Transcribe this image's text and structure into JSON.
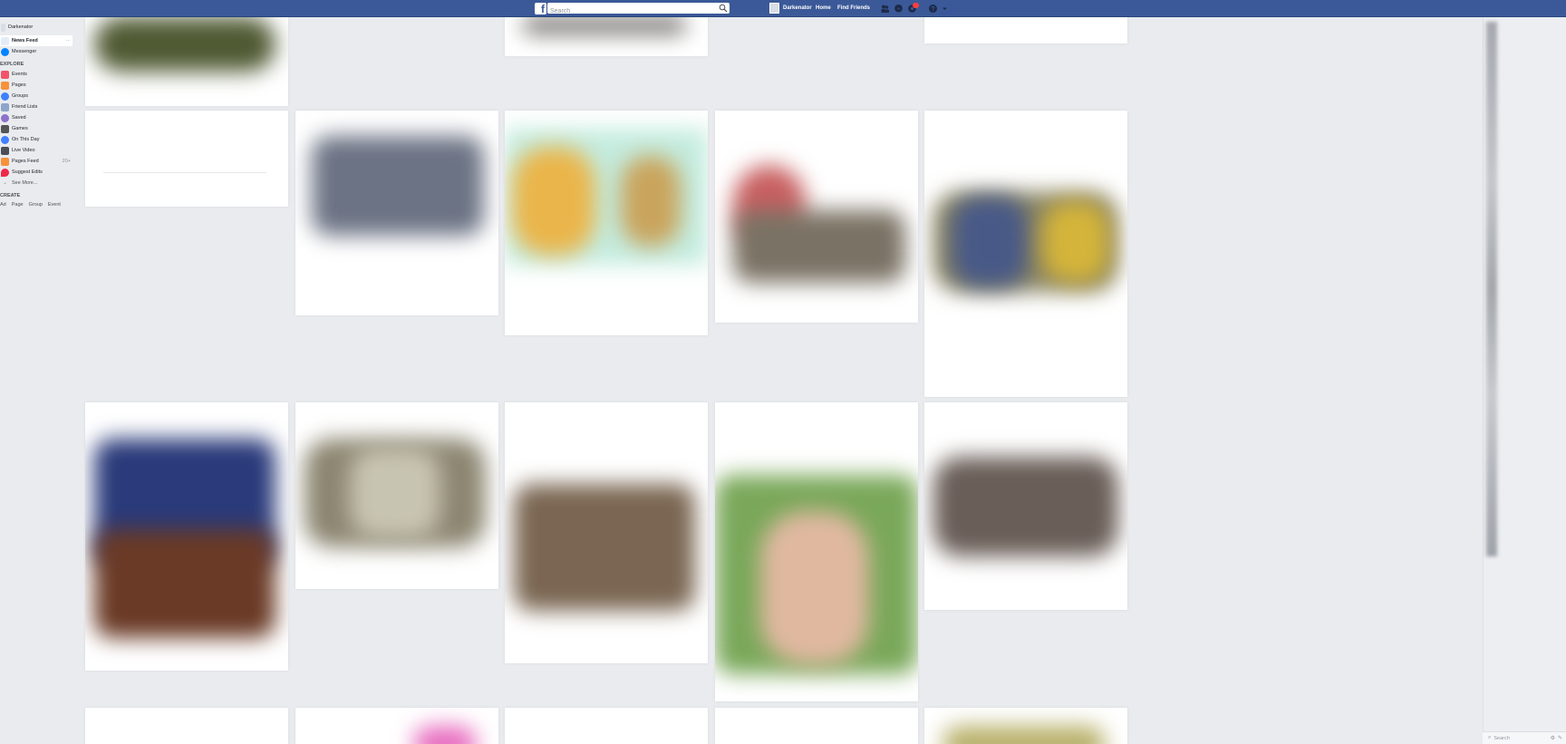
{
  "topbar": {
    "logo": "f",
    "search_placeholder": "Search",
    "user_name": "Darkenator",
    "home_label": "Home",
    "find_friends_label": "Find Friends",
    "icons": [
      "friend-requests-icon",
      "messages-icon",
      "notifications-icon",
      "help-icon",
      "account-dropdown-icon"
    ],
    "colors": {
      "bar": "#3b5998",
      "badge": "#fa3e3e"
    }
  },
  "sidebar": {
    "profile_name": "Darkenator",
    "news_feed": "News Feed",
    "news_feed_more": "···",
    "messenger": "Messenger",
    "explore_heading": "EXPLORE",
    "explore_items": [
      {
        "label": "Events",
        "icon": "calendar-icon",
        "color": "#f35369"
      },
      {
        "label": "Pages",
        "icon": "flag-icon",
        "color": "#f7923b"
      },
      {
        "label": "Groups",
        "icon": "groups-icon",
        "color": "#4080ff"
      },
      {
        "label": "Friend Lists",
        "icon": "friend-list-icon",
        "color": "#8ea5c9"
      },
      {
        "label": "Saved",
        "icon": "bookmark-icon",
        "color": "#8c72cb"
      },
      {
        "label": "Games",
        "icon": "games-icon",
        "color": "#555"
      },
      {
        "label": "On This Day",
        "icon": "clock-icon",
        "color": "#4080ff"
      },
      {
        "label": "Live Video",
        "icon": "live-video-icon",
        "color": "#4b4f56"
      },
      {
        "label": "Pages Feed",
        "icon": "pages-feed-icon",
        "color": "#f7923b",
        "count": "20+"
      },
      {
        "label": "Suggest Edits",
        "icon": "map-pin-icon",
        "color": "#f02849"
      }
    ],
    "see_more": "See More...",
    "create_heading": "CREATE",
    "create_items": [
      "Ad",
      "Page",
      "Group",
      "Event"
    ]
  },
  "chat": {
    "search_placeholder": "Search"
  }
}
